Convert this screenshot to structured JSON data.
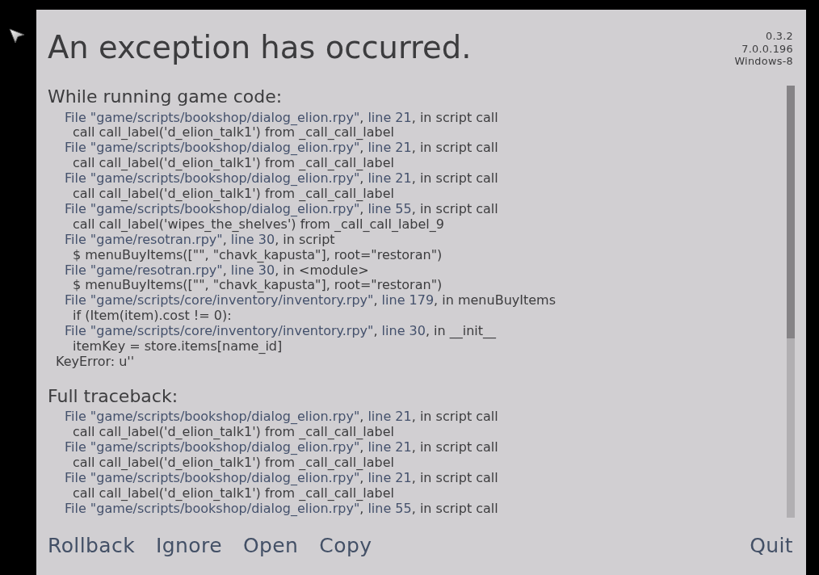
{
  "title": "An exception has occurred.",
  "version_info": [
    "0.3.2",
    "7.0.0.196",
    "Windows-8"
  ],
  "sections": [
    {
      "heading": "While running game code:",
      "frames": [
        {
          "file": "File \"game/scripts/bookshop/dialog_elion.rpy\"",
          "sep": ", ",
          "line": "line 21",
          "context": ", in script call",
          "code": "call call_label('d_elion_talk1') from _call_call_label"
        },
        {
          "file": "File \"game/scripts/bookshop/dialog_elion.rpy\"",
          "sep": ", ",
          "line": "line 21",
          "context": ", in script call",
          "code": "call call_label('d_elion_talk1') from _call_call_label"
        },
        {
          "file": "File \"game/scripts/bookshop/dialog_elion.rpy\"",
          "sep": ", ",
          "line": "line 21",
          "context": ", in script call",
          "code": "call call_label('d_elion_talk1') from _call_call_label"
        },
        {
          "file": "File \"game/scripts/bookshop/dialog_elion.rpy\"",
          "sep": ", ",
          "line": "line 55",
          "context": ", in script call",
          "code": "call call_label('wipes_the_shelves') from _call_call_label_9"
        },
        {
          "file": "File \"game/resotran.rpy\"",
          "sep": ", ",
          "line": "line 30",
          "context": ", in script",
          "code": "$ menuBuyItems([\"\", \"chavk_kapusta\"], root=\"restoran\")"
        },
        {
          "file": "File \"game/resotran.rpy\"",
          "sep": ", ",
          "line": "line 30",
          "context": ", in <module>",
          "code": "$ menuBuyItems([\"\", \"chavk_kapusta\"], root=\"restoran\")"
        },
        {
          "file": "File \"game/scripts/core/inventory/inventory.rpy\"",
          "sep": ", ",
          "line": "line 179",
          "context": ", in menuBuyItems",
          "code": "if (Item(item).cost != 0):"
        },
        {
          "file": "File \"game/scripts/core/inventory/inventory.rpy\"",
          "sep": ", ",
          "line": "line 30",
          "context": ", in __init__",
          "code": "itemKey = store.items[name_id]"
        }
      ],
      "error": "KeyError: u''"
    },
    {
      "heading": "Full traceback:",
      "frames": [
        {
          "file": "File \"game/scripts/bookshop/dialog_elion.rpy\"",
          "sep": ", ",
          "line": "line 21",
          "context": ", in script call",
          "code": "call call_label('d_elion_talk1') from _call_call_label"
        },
        {
          "file": "File \"game/scripts/bookshop/dialog_elion.rpy\"",
          "sep": ", ",
          "line": "line 21",
          "context": ", in script call",
          "code": "call call_label('d_elion_talk1') from _call_call_label"
        },
        {
          "file": "File \"game/scripts/bookshop/dialog_elion.rpy\"",
          "sep": ", ",
          "line": "line 21",
          "context": ", in script call",
          "code": "call call_label('d_elion_talk1') from _call_call_label"
        },
        {
          "file": "File \"game/scripts/bookshop/dialog_elion.rpy\"",
          "sep": ", ",
          "line": "line 55",
          "context": ", in script call"
        }
      ]
    }
  ],
  "buttons": [
    "Rollback",
    "Ignore",
    "Open",
    "Copy"
  ],
  "quit_button": "Quit"
}
